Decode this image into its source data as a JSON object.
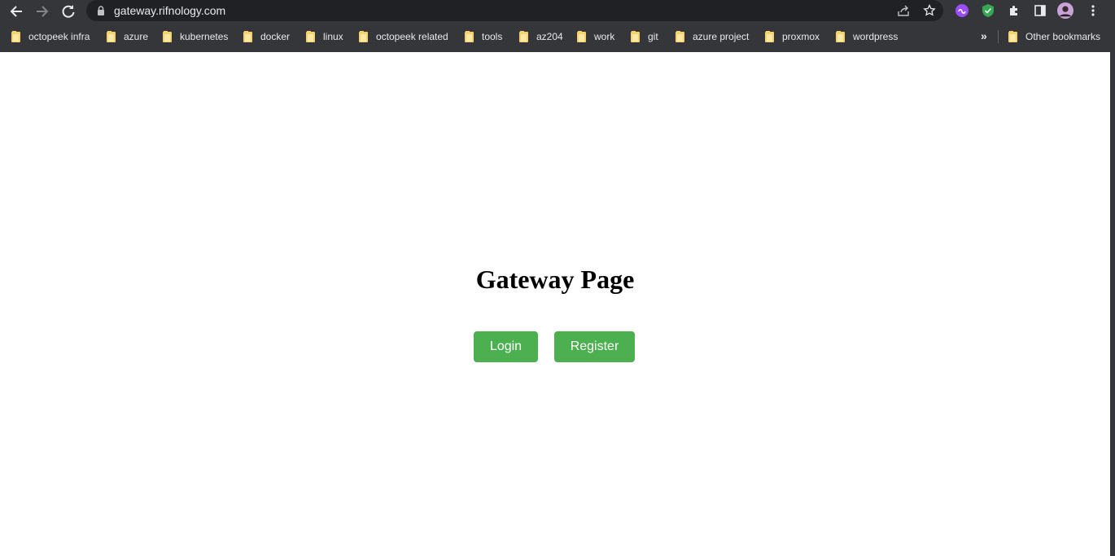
{
  "browser": {
    "url": "gateway.rifnology.com",
    "bookmarks": [
      {
        "label": "octopeek infra"
      },
      {
        "label": "azure"
      },
      {
        "label": "kubernetes"
      },
      {
        "label": "docker"
      },
      {
        "label": "linux"
      },
      {
        "label": "octopeek related"
      },
      {
        "label": "tools"
      },
      {
        "label": "az204"
      },
      {
        "label": "work"
      },
      {
        "label": "git"
      },
      {
        "label": "azure project"
      },
      {
        "label": "proxmox"
      },
      {
        "label": "wordpress"
      }
    ],
    "overflow_label": "»",
    "other_bookmarks_label": "Other bookmarks"
  },
  "page": {
    "title": "Gateway Page",
    "login_label": "Login",
    "register_label": "Register",
    "button_color": "#4caf50"
  }
}
